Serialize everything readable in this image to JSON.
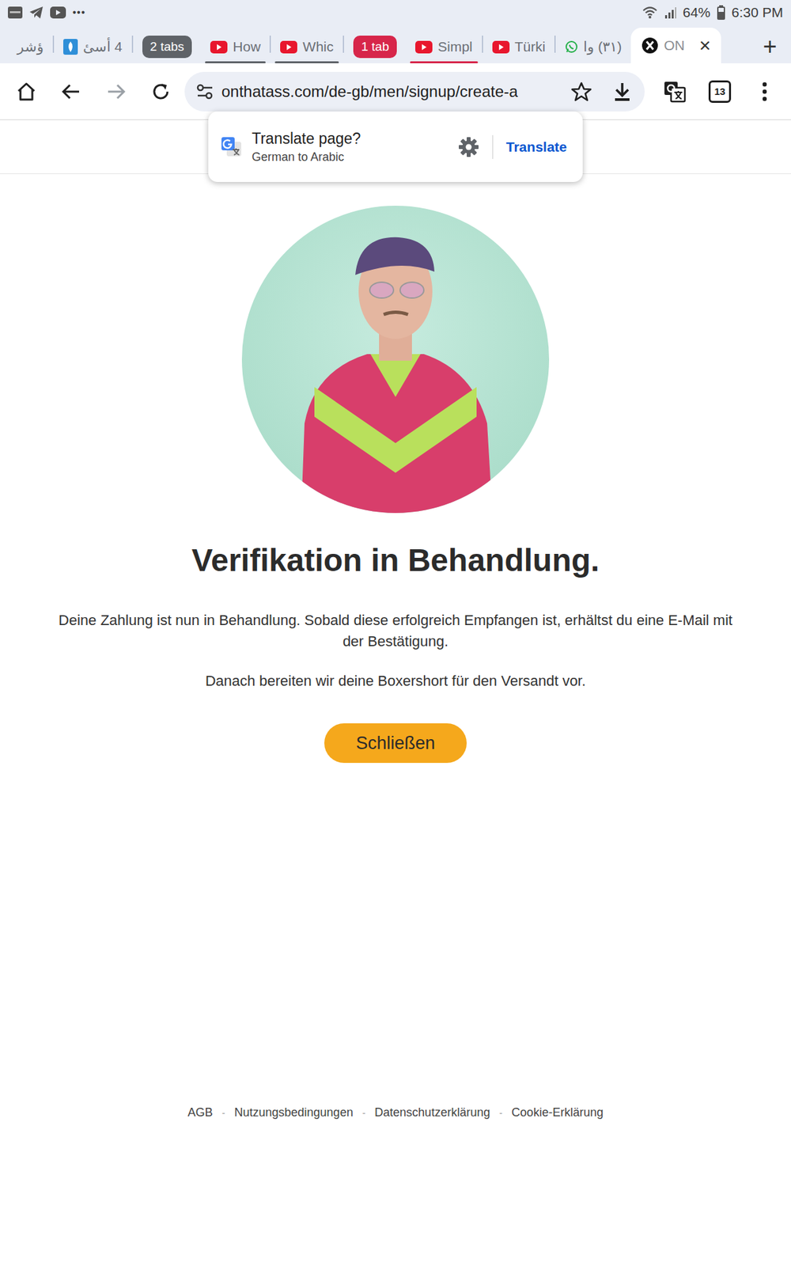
{
  "status_bar": {
    "more": "•••",
    "battery": "64%",
    "time": "6:30 PM"
  },
  "tabs": [
    {
      "label": "ؤشر",
      "kind": "plain",
      "selected": false
    },
    {
      "label": "4 أسئ",
      "kind": "news",
      "selected": false
    },
    {
      "label": "2 tabs",
      "kind": "group",
      "selected": false,
      "color": "#5f6368"
    },
    {
      "label": "How",
      "kind": "youtube",
      "selected": false,
      "color": "#5f6368"
    },
    {
      "label": "Whic",
      "kind": "youtube",
      "selected": false,
      "color": "#5f6368"
    },
    {
      "label": "1 tab",
      "kind": "group",
      "selected": false,
      "color": "#d7264a"
    },
    {
      "label": "Simpl",
      "kind": "youtube",
      "selected": false,
      "color": "#d7264a"
    },
    {
      "label": "Türki",
      "kind": "youtube",
      "selected": false
    },
    {
      "label": "(٣١) وا",
      "kind": "whatsapp",
      "selected": false
    },
    {
      "label": "ON",
      "kind": "site",
      "selected": true,
      "close": "×"
    }
  ],
  "new_tab": "+",
  "toolbar": {
    "url": "onthatass.com/de-gb/men/signup/create-a",
    "forward_disabled": true,
    "tab_count": "13"
  },
  "translate_popup": {
    "title": "Translate page?",
    "subtitle": "German to Arabic",
    "action": "Translate"
  },
  "page": {
    "heading": "Verifikation in Behandlung.",
    "paragraphs": [
      "Deine Zahlung ist nun in Behandlung. Sobald diese erfolgreich Empfangen ist, erhältst du eine E-Mail mit der Bestätigung.",
      "Danach bereiten wir deine Boxershort für den Versandt vor."
    ],
    "button": "Schließen"
  },
  "footer": {
    "links": [
      "AGB",
      "Nutzungsbedingungen",
      "Datenschutzerklärung",
      "Cookie-Erklärung"
    ],
    "separator": "-"
  }
}
